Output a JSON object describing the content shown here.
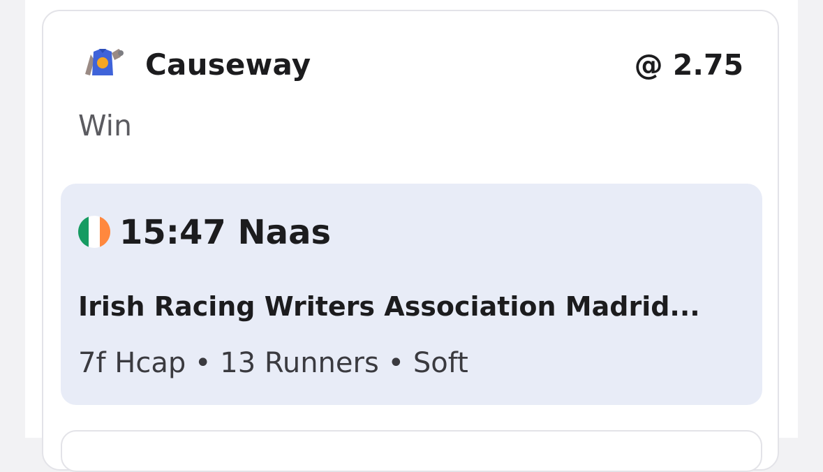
{
  "selection": {
    "name": "Causeway",
    "odds": "@ 2.75",
    "market": "Win",
    "silk_icon": "jockey-silk-icon",
    "silk_colors": {
      "body": "#3f63d9",
      "spot": "#f5a623",
      "sleeves": "#9a8a84",
      "cap": "#7d7d82"
    }
  },
  "race": {
    "time_venue": "15:47 Naas",
    "flag_icon": "ireland-flag-icon",
    "flag_colors": [
      "#169b62",
      "#ffffff",
      "#ff883e"
    ],
    "title": "Irish Racing Writers Association Madrid...",
    "details": "7f Hcap • 13 Runners • Soft"
  }
}
